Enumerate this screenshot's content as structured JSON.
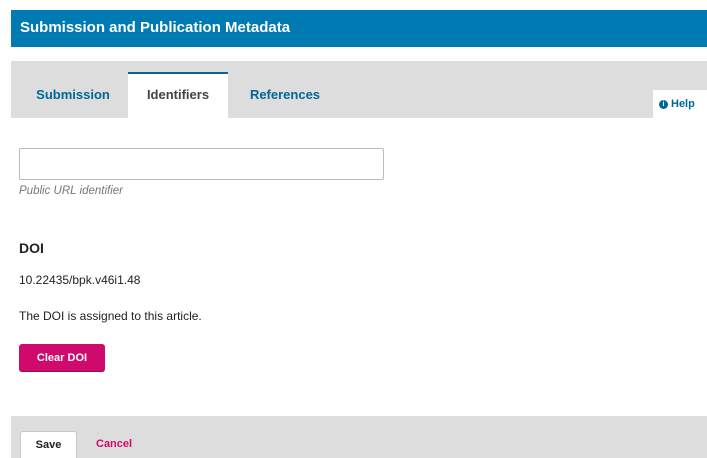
{
  "header": {
    "title": "Submission and Publication Metadata"
  },
  "tabs": [
    {
      "label": "Submission",
      "active": false
    },
    {
      "label": "Identifiers",
      "active": true
    },
    {
      "label": "References",
      "active": false
    }
  ],
  "help": {
    "label": "Help",
    "icon": "info-icon"
  },
  "url_field": {
    "value": "",
    "placeholder": "",
    "description": "Public URL identifier"
  },
  "doi": {
    "heading": "DOI",
    "value": "10.22435/bpk.v46i1.48",
    "note": "The DOI is assigned to this article.",
    "clear_label": "Clear DOI"
  },
  "footer": {
    "save_label": "Save",
    "cancel_label": "Cancel"
  },
  "colors": {
    "header_bg": "#007ab2",
    "tab_text": "#006798",
    "accent_pink": "#d00a6c",
    "panel_gray": "#dddddd"
  }
}
